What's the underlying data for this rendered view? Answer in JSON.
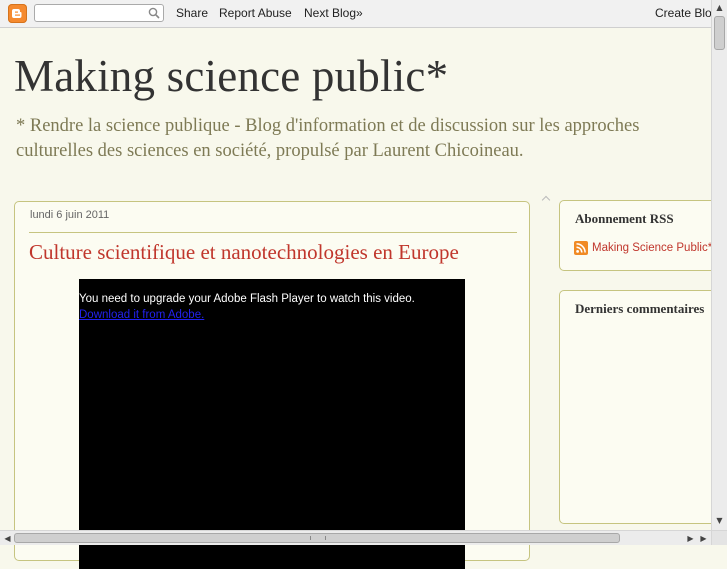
{
  "navbar": {
    "search": {
      "value": "",
      "placeholder": ""
    },
    "links": {
      "share": "Share",
      "report_abuse": "Report Abuse",
      "next_blog": "Next Blog»",
      "create_blog": "Create Blog"
    }
  },
  "header": {
    "title": "Making science public*",
    "description": "* Rendre la science publique - Blog d'information et de discussion sur les approches culturelles des sciences en société, propulsé par Laurent Chicoineau."
  },
  "post": {
    "date": "lundi 6 juin 2011",
    "title": "Culture scientifique et nanotechnologies en Europe",
    "video": {
      "message": "You need to upgrade your Adobe Flash Player to watch this video.",
      "link": "Download it from Adobe."
    }
  },
  "sidebar": {
    "rss_widget": {
      "title": "Abonnement RSS",
      "link": "Making Science Public*"
    },
    "comments_widget": {
      "title": "Derniers commentaires"
    }
  },
  "colors": {
    "background": "#f8f8ec",
    "accent_red": "#c0362c",
    "border_olive": "#c6c480",
    "description_text": "#7e7a55"
  }
}
